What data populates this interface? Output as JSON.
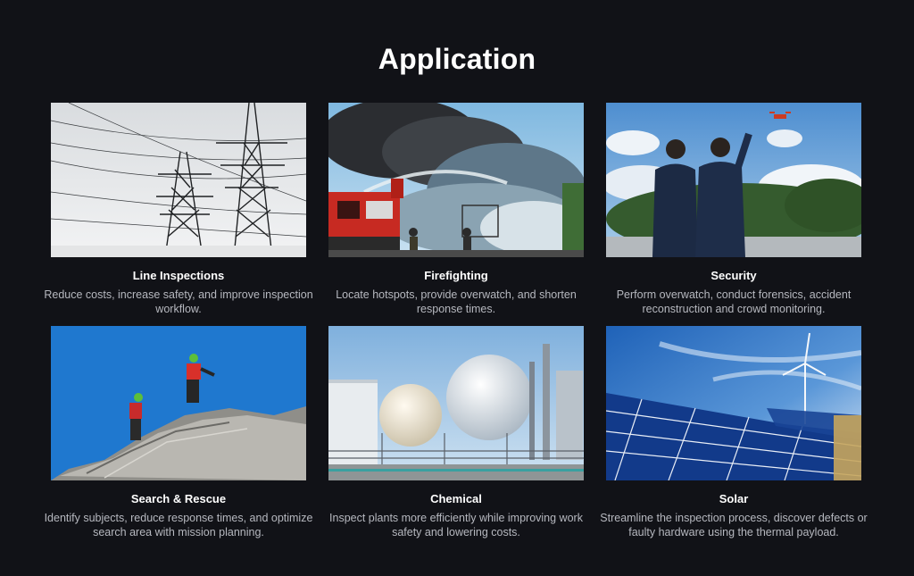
{
  "page": {
    "title": "Application",
    "background": "#111217",
    "text_color": "#ffffff",
    "desc_color": "#b6b8bf"
  },
  "cards": [
    {
      "title": "Line Inspections",
      "description": "Reduce costs, increase safety, and improve inspection workflow.",
      "image": "power-lines-photo"
    },
    {
      "title": "Firefighting",
      "description": "Locate hotspots, provide overwatch, and shorten response times.",
      "image": "firefighting-photo"
    },
    {
      "title": "Security",
      "description": "Perform overwatch, conduct forensics, accident reconstruction and crowd monitoring.",
      "image": "security-photo"
    },
    {
      "title": "Search & Rescue",
      "description": "Identify subjects, reduce response times, and optimize search area with mission planning.",
      "image": "search-rescue-photo"
    },
    {
      "title": "Chemical",
      "description": "Inspect plants more efficiently while improving work safety and lowering costs.",
      "image": "chemical-plant-photo"
    },
    {
      "title": "Solar",
      "description": "Streamline the inspection process, discover defects or faulty hardware using the thermal payload.",
      "image": "solar-panels-photo"
    }
  ]
}
